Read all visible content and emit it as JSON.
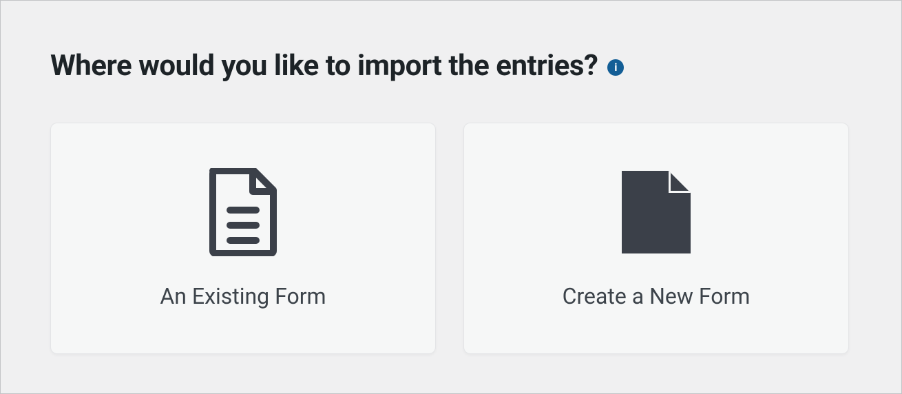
{
  "heading": "Where would you like to import the entries?",
  "info_tooltip_char": "i",
  "options": {
    "existing": {
      "label": "An Existing Form",
      "icon": "document-text-icon"
    },
    "new": {
      "label": "Create a New Form",
      "icon": "document-blank-icon"
    }
  },
  "colors": {
    "icon_dark": "#3b4049",
    "info_bg": "#135e96"
  }
}
